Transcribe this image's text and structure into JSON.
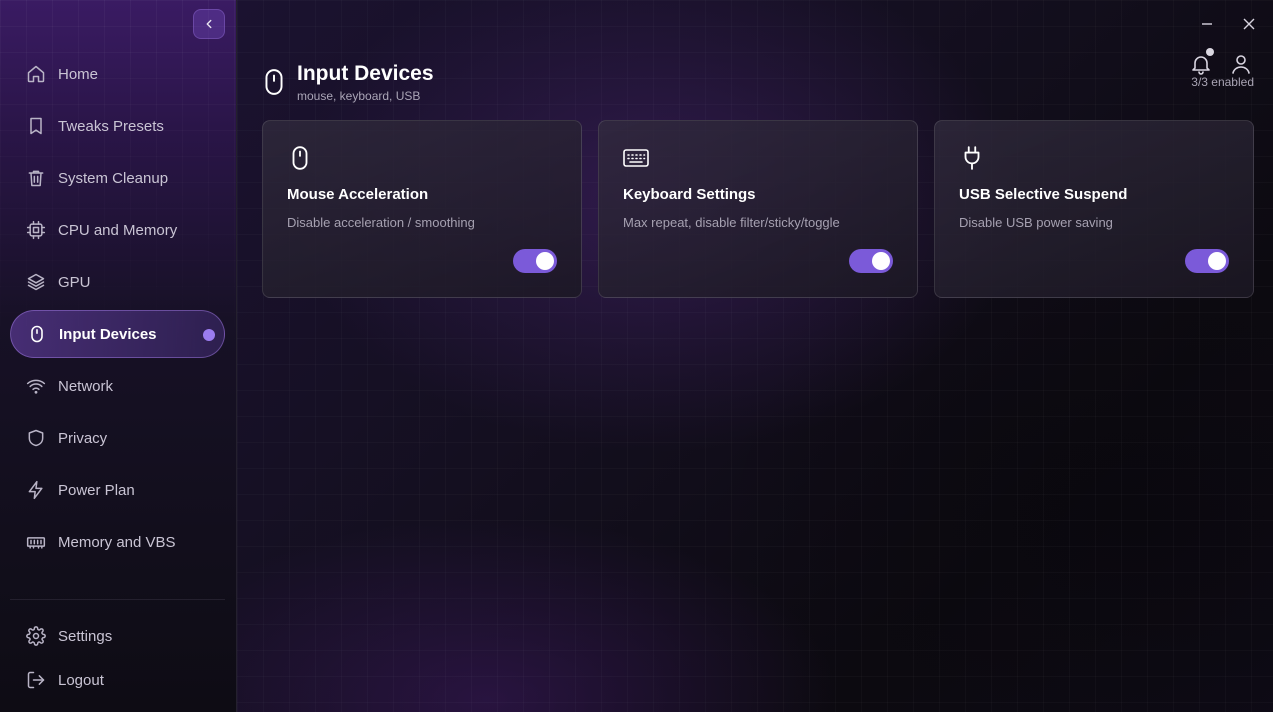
{
  "sidebar": {
    "items": [
      {
        "label": "Home",
        "icon": "home-icon"
      },
      {
        "label": "Tweaks Presets",
        "icon": "bookmark-icon"
      },
      {
        "label": "System Cleanup",
        "icon": "trash-icon"
      },
      {
        "label": "CPU and Memory",
        "icon": "cpu-icon"
      },
      {
        "label": "GPU",
        "icon": "layers-icon"
      },
      {
        "label": "Input Devices",
        "icon": "mouse-icon",
        "active": true
      },
      {
        "label": "Network",
        "icon": "wifi-icon"
      },
      {
        "label": "Privacy",
        "icon": "shield-icon"
      },
      {
        "label": "Power Plan",
        "icon": "lightning-icon"
      },
      {
        "label": "Memory and VBS",
        "icon": "memory-icon"
      }
    ],
    "bottom": [
      {
        "label": "Settings",
        "icon": "gear-icon"
      },
      {
        "label": "Logout",
        "icon": "logout-icon"
      }
    ]
  },
  "header": {
    "title": "Input Devices",
    "subtitle": "mouse, keyboard, USB",
    "enabled_count": "3/3 enabled"
  },
  "cards": [
    {
      "title": "Mouse Acceleration",
      "description": "Disable acceleration / smoothing",
      "icon": "mouse-icon",
      "enabled": true
    },
    {
      "title": "Keyboard Settings",
      "description": "Max repeat, disable filter/sticky/toggle",
      "icon": "keyboard-icon",
      "enabled": true
    },
    {
      "title": "USB Selective Suspend",
      "description": "Disable USB power saving",
      "icon": "plug-icon",
      "enabled": true
    }
  ],
  "colors": {
    "accent": "#7b5ad9",
    "active_dot": "#9b7cf0",
    "text_muted": "#a6a1b1"
  }
}
